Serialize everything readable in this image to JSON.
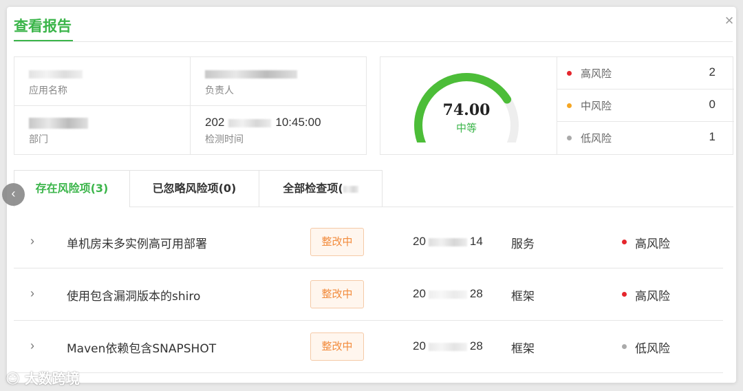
{
  "dialog": {
    "title": "查看报告",
    "close_label": "×"
  },
  "info": {
    "app_name_label": "应用名称",
    "owner_label": "负责人",
    "department_label": "部门",
    "detect_time_label": "检测时间",
    "detect_time_value_prefix": "202",
    "detect_time_value_suffix": "10:45:00"
  },
  "score": {
    "value": "74.00",
    "level": "中等",
    "gauge_fraction": 0.74,
    "gauge_color": "#4cbd38",
    "track_color": "#eeeeee"
  },
  "risk_summary": [
    {
      "name": "高风险",
      "count": "2",
      "color": "#e5262d"
    },
    {
      "name": "中风险",
      "count": "0",
      "color": "#f5a623"
    },
    {
      "name": "低风险",
      "count": "1",
      "color": "#aaaaaa"
    }
  ],
  "tabs": [
    {
      "label": "存在风险项(3)",
      "active": true
    },
    {
      "label": "已忽略风险项(0)",
      "active": false
    },
    {
      "label": "全部检查项(",
      "active": false
    }
  ],
  "nav": {
    "prev_label": "‹"
  },
  "rows": [
    {
      "title": "单机房未多实例高可用部署",
      "status": "整改中",
      "date_prefix": "20",
      "date_suffix": "14",
      "type": "服务",
      "risk": "高风险",
      "risk_color": "#e5262d"
    },
    {
      "title": "使用包含漏洞版本的shiro",
      "status": "整改中",
      "date_prefix": "20",
      "date_suffix": "28",
      "type": "框架",
      "risk": "高风险",
      "risk_color": "#e5262d"
    },
    {
      "title": "Maven依赖包含SNAPSHOT",
      "status": "整改中",
      "date_prefix": "20",
      "date_suffix": "28",
      "type": "框架",
      "risk": "低风险",
      "risk_color": "#aaaaaa"
    }
  ],
  "watermark": "大数跨境",
  "theme": {
    "accent": "#3bb54a",
    "badge_text": "#f28b3c"
  }
}
